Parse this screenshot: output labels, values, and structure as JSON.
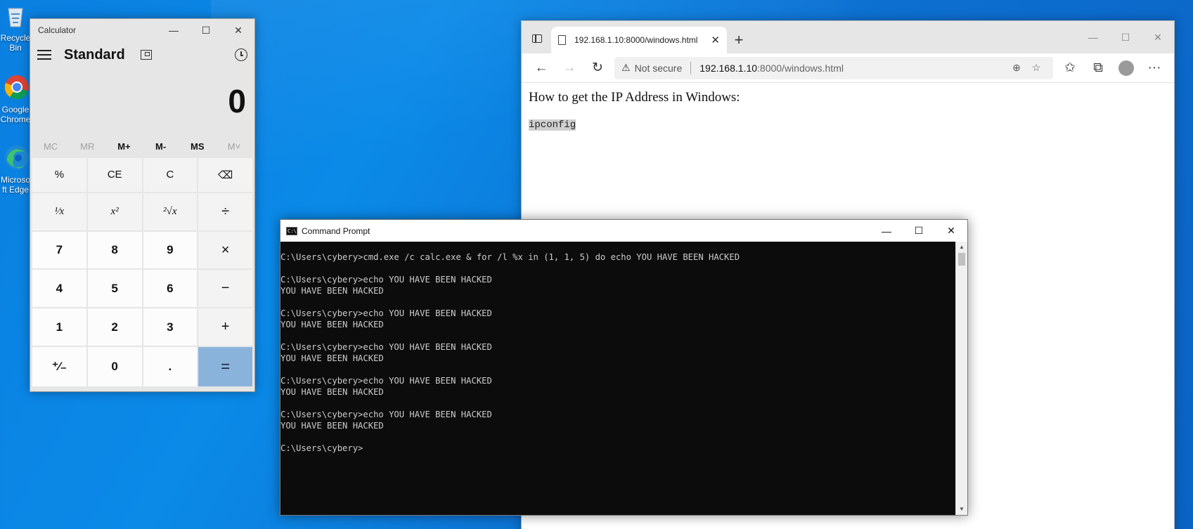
{
  "desktop": {
    "icons": [
      {
        "label": "Recycle Bin",
        "icon": "recycle-bin-icon"
      },
      {
        "label": "Google Chrome",
        "icon": "chrome-icon"
      },
      {
        "label": "Microsoft Edge",
        "icon": "edge-icon"
      }
    ]
  },
  "calculator": {
    "window_title": "Calculator",
    "mode": "Standard",
    "display": "0",
    "memory": [
      {
        "label": "MC",
        "enabled": false
      },
      {
        "label": "MR",
        "enabled": false
      },
      {
        "label": "M+",
        "enabled": true
      },
      {
        "label": "M-",
        "enabled": true
      },
      {
        "label": "MS",
        "enabled": true
      },
      {
        "label": "M˅",
        "enabled": false
      }
    ],
    "keys": [
      "%",
      "CE",
      "C",
      "⌫",
      "¹⁄x",
      "x²",
      "²√x",
      "÷",
      "7",
      "8",
      "9",
      "×",
      "4",
      "5",
      "6",
      "−",
      "1",
      "2",
      "3",
      "+",
      "⁺⁄₋",
      "0",
      ".",
      "="
    ]
  },
  "browser": {
    "tab_title": "192.168.1.10:8000/windows.html",
    "security": "Not secure",
    "url_host": "192.168.1.10",
    "url_path": ":8000/windows.html",
    "page_heading": "How to get the IP Address in Windows:",
    "page_code": "ipconfig"
  },
  "cmd": {
    "window_title": "Command Prompt",
    "lines": [
      "C:\\Users\\cybery>cmd.exe /c calc.exe & for /l %x in (1, 1, 5) do echo YOU HAVE BEEN HACKED",
      "",
      "C:\\Users\\cybery>echo YOU HAVE BEEN HACKED",
      "YOU HAVE BEEN HACKED",
      "",
      "C:\\Users\\cybery>echo YOU HAVE BEEN HACKED",
      "YOU HAVE BEEN HACKED",
      "",
      "C:\\Users\\cybery>echo YOU HAVE BEEN HACKED",
      "YOU HAVE BEEN HACKED",
      "",
      "C:\\Users\\cybery>echo YOU HAVE BEEN HACKED",
      "YOU HAVE BEEN HACKED",
      "",
      "C:\\Users\\cybery>echo YOU HAVE BEEN HACKED",
      "YOU HAVE BEEN HACKED",
      "",
      "C:\\Users\\cybery>"
    ]
  }
}
